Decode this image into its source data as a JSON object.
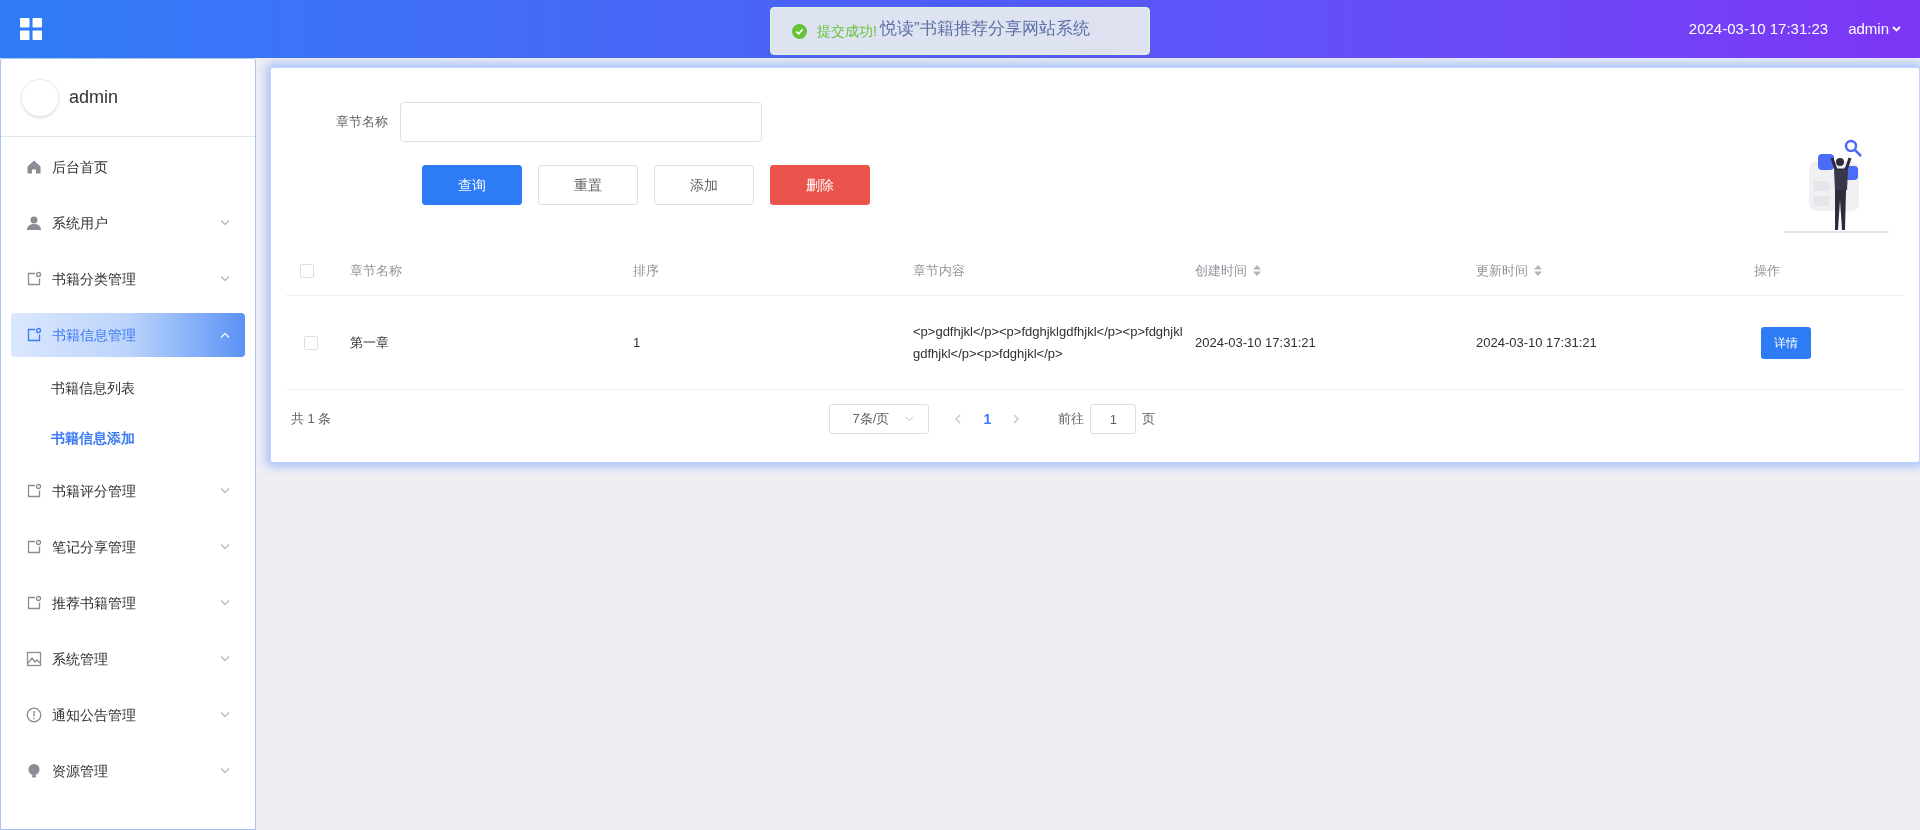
{
  "header": {
    "title": "悦读”书籍推荐分享网站系统",
    "datetime": "2024-03-10 17:31:23",
    "user": "admin"
  },
  "toast": {
    "message": "提交成功!"
  },
  "profile": {
    "name": "admin"
  },
  "menu": [
    {
      "label": "后台首页",
      "kind": "home",
      "expandable": false,
      "selected": false
    },
    {
      "label": "系统用户",
      "kind": "user",
      "expandable": true,
      "expanded": false,
      "selected": false
    },
    {
      "label": "书籍分类管理",
      "kind": "tag",
      "expandable": true,
      "expanded": false,
      "selected": false
    },
    {
      "label": "书籍信息管理",
      "kind": "tag",
      "expandable": true,
      "expanded": true,
      "selected": true,
      "children": [
        {
          "label": "书籍信息列表",
          "selected": false
        },
        {
          "label": "书籍信息添加",
          "selected": true
        }
      ]
    },
    {
      "label": "书籍评分管理",
      "kind": "tag",
      "expandable": true,
      "expanded": false,
      "selected": false
    },
    {
      "label": "笔记分享管理",
      "kind": "tag",
      "expandable": true,
      "expanded": false,
      "selected": false
    },
    {
      "label": "推荐书籍管理",
      "kind": "tag",
      "expandable": true,
      "expanded": false,
      "selected": false
    },
    {
      "label": "系统管理",
      "kind": "image",
      "expandable": true,
      "expanded": false,
      "selected": false
    },
    {
      "label": "通知公告管理",
      "kind": "alert",
      "expandable": true,
      "expanded": false,
      "selected": false
    },
    {
      "label": "资源管理",
      "kind": "bulb",
      "expandable": true,
      "expanded": false,
      "selected": false
    }
  ],
  "search": {
    "label": "章节名称"
  },
  "buttons": [
    {
      "label": "查询",
      "kind": "primary"
    },
    {
      "label": "重置",
      "kind": "default"
    },
    {
      "label": "添加",
      "kind": "default"
    },
    {
      "label": "删除",
      "kind": "danger"
    }
  ],
  "table": {
    "header_checked": false,
    "columns": [
      {
        "label": "章节名称",
        "sortable": false
      },
      {
        "label": "排序",
        "sortable": false
      },
      {
        "label": "章节内容",
        "sortable": false
      },
      {
        "label": "创建时间",
        "sortable": true
      },
      {
        "label": "更新时间",
        "sortable": true
      },
      {
        "label": "操作",
        "sortable": false
      }
    ],
    "rows": [
      {
        "checked": false,
        "cells": [
          "第一章",
          "1",
          "<p>gdfhjkl</p><p>fdghjklgdfhjkl</p><p>fdghjklgdfhjkl</p><p>fdghjkl</p>",
          "2024-03-10 17:31:21",
          "2024-03-10 17:31:21"
        ],
        "action": "详情"
      }
    ]
  },
  "pagination": {
    "total": "共 1 条",
    "page_size": "7条/页",
    "pages": [
      {
        "label": "1",
        "selected": true
      }
    ],
    "goto_label": "前往",
    "goto_value": "1",
    "goto_suffix": "页"
  }
}
